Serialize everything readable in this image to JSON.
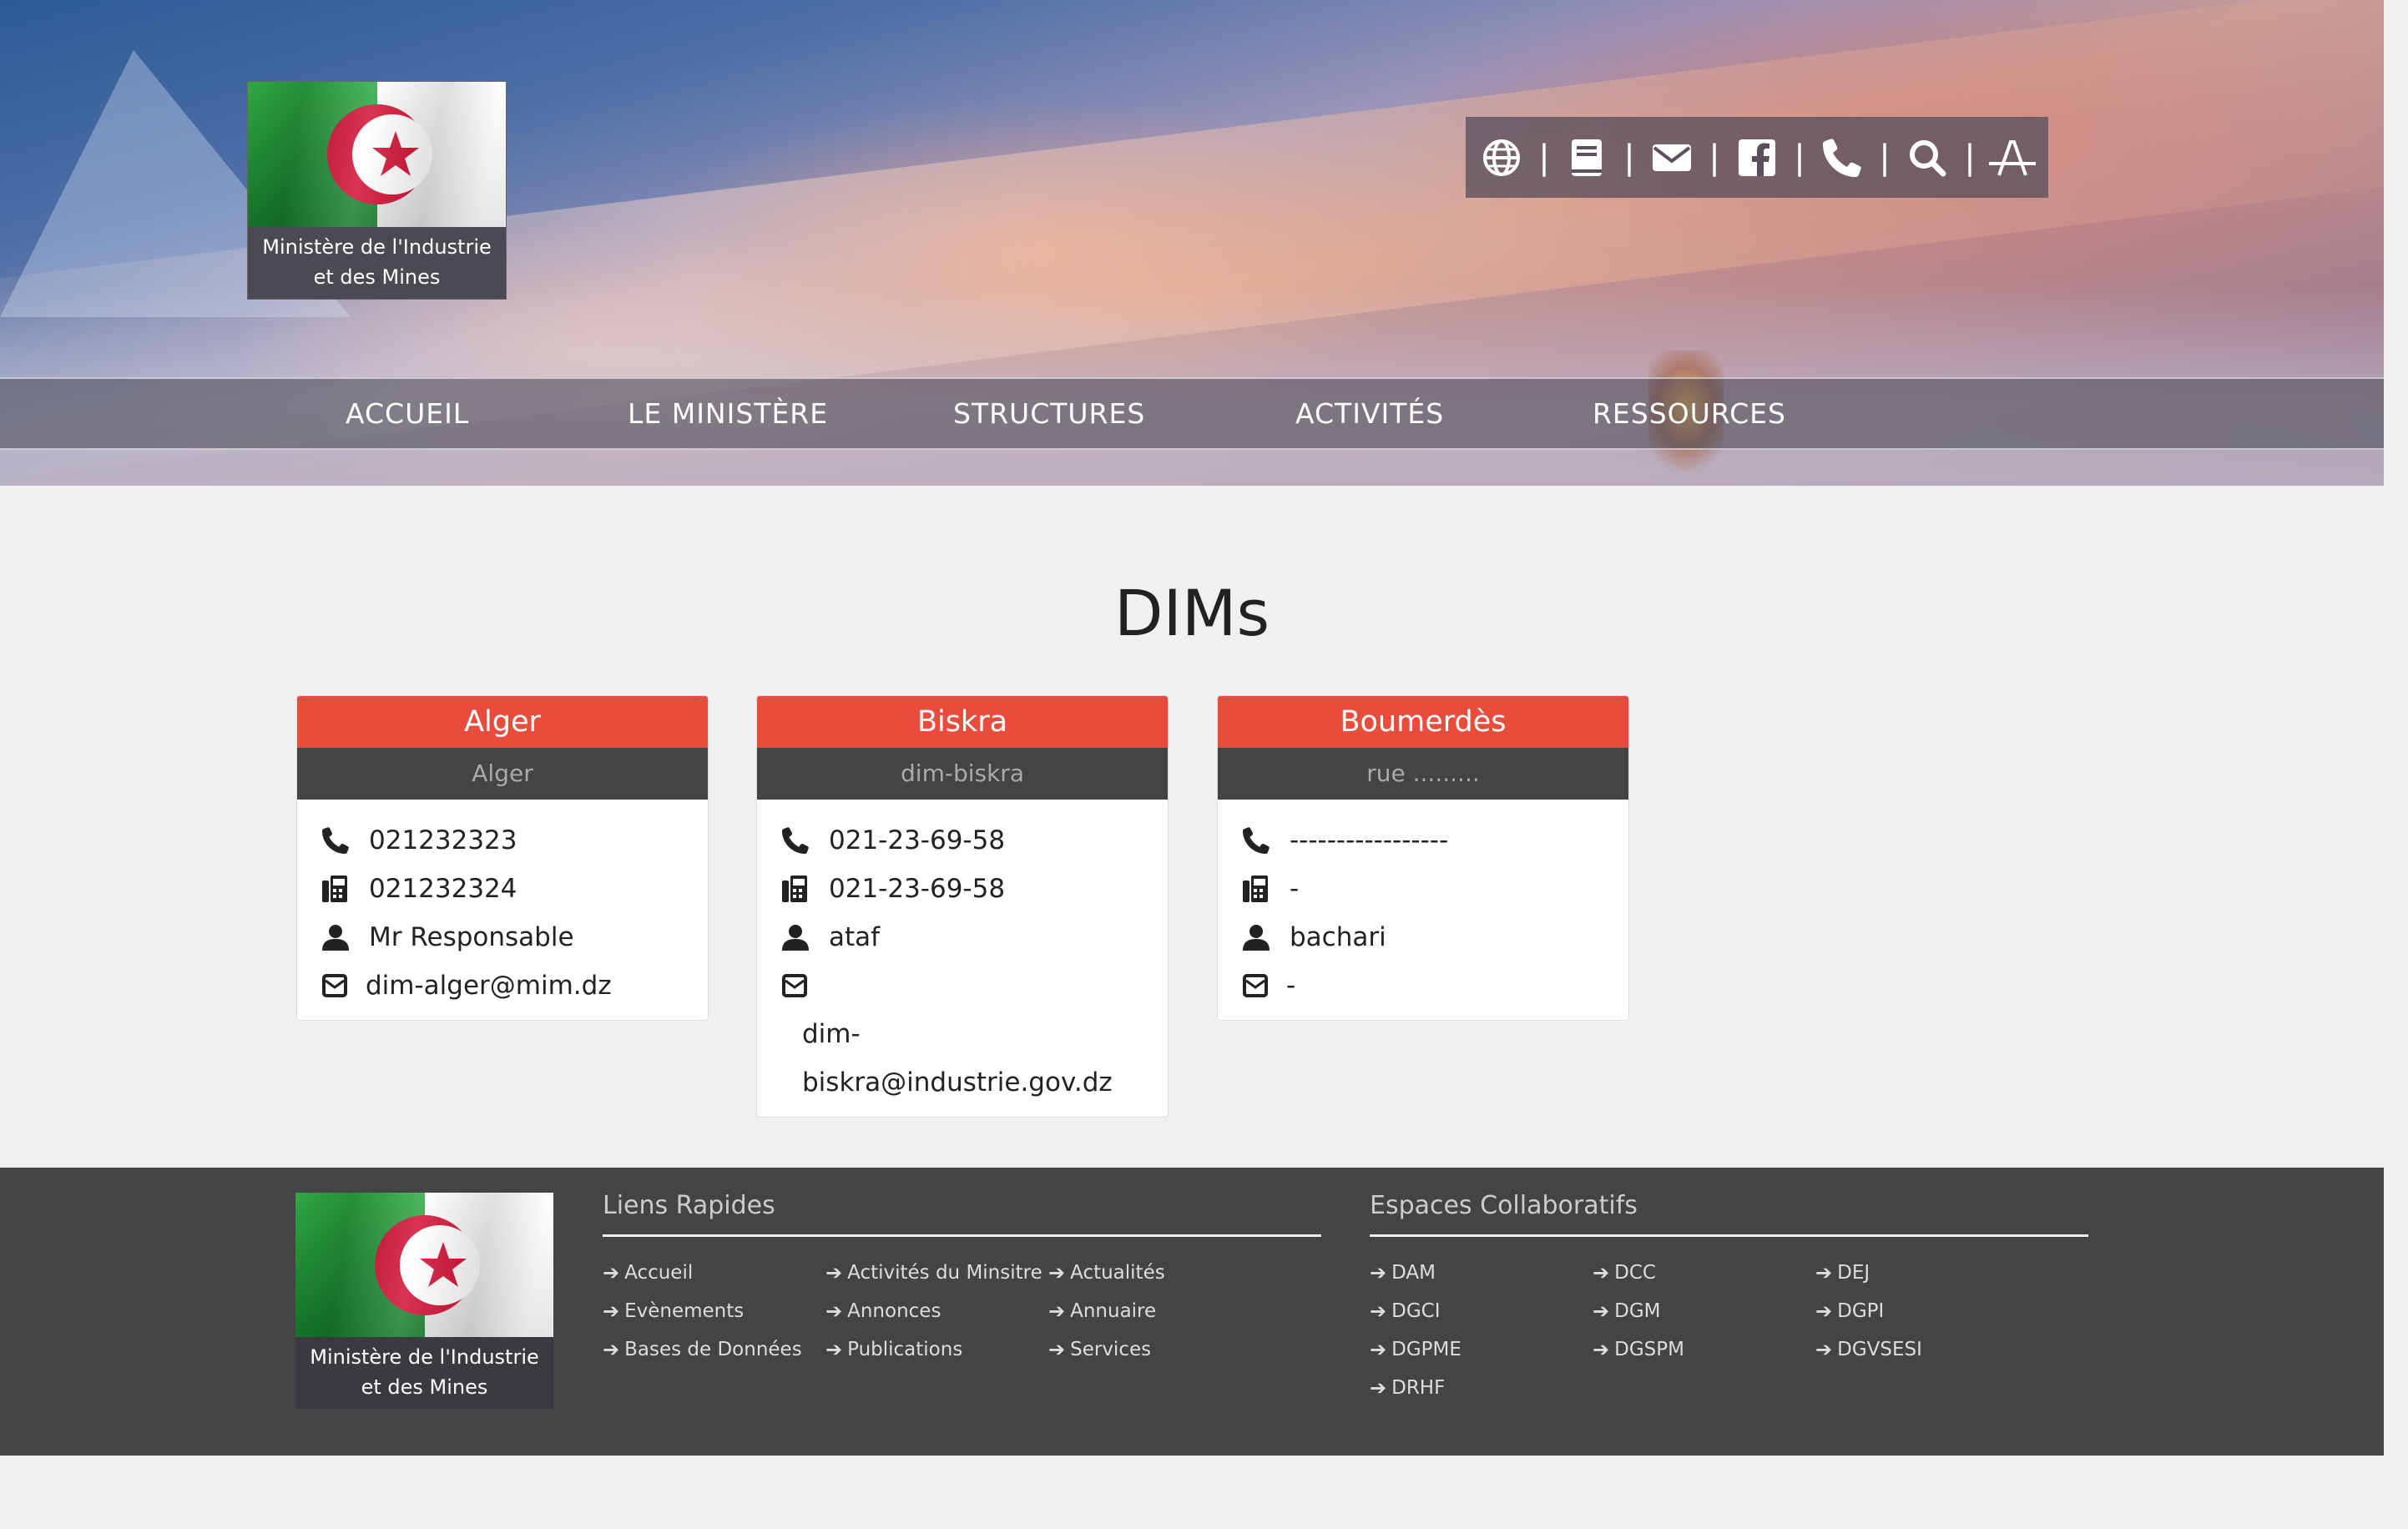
{
  "logo": {
    "caption_line1": "Ministère de l'Industrie",
    "caption_line2": "et des Mines"
  },
  "toolbar": {
    "icons": [
      "globe-icon",
      "book-icon",
      "envelope-icon",
      "facebook-icon",
      "phone-icon",
      "search-icon",
      "text-size-icon"
    ],
    "separator": "|"
  },
  "nav": {
    "items": [
      "ACCUEIL",
      "LE MINISTÈRE",
      "STRUCTURES",
      "ACTIVITÉS",
      "RESSOURCES"
    ]
  },
  "main": {
    "title": "DIMs",
    "colors": {
      "accent": "#e74c3c",
      "subheader": "#444444"
    },
    "cards": [
      {
        "city": "Alger",
        "address": "Alger",
        "phone": "021232323",
        "fax": "021232324",
        "contact": "Mr Responsable",
        "email": "dim-alger@mim.dz"
      },
      {
        "city": "Biskra",
        "address": "dim-biskra",
        "phone": "021-23-69-58",
        "fax": "021-23-69-58",
        "contact": "ataf",
        "email_line1": "dim-",
        "email_line2": "biskra@industrie.gov.dz"
      },
      {
        "city": "Boumerdès",
        "address": "rue .........",
        "phone": "-----------------",
        "fax": "-",
        "contact": "bachari",
        "email": "-"
      }
    ]
  },
  "footer": {
    "logo_caption_line1": "Ministère de l'Industrie",
    "logo_caption_line2": "et des Mines",
    "quick_links": {
      "title": "Liens Rapides",
      "col1": [
        "Accueil",
        "Evènements",
        "Bases de Données"
      ],
      "col2": [
        "Activités du Minsitre",
        "Annonces",
        "Publications"
      ],
      "col3": [
        "Actualités",
        "Annuaire",
        "Services"
      ]
    },
    "collab": {
      "title": "Espaces Collaboratifs",
      "col1": [
        "DAM",
        "DGCI",
        "DGPME",
        "DRHF"
      ],
      "col2": [
        "DCC",
        "DGM",
        "DGSPM"
      ],
      "col3": [
        "DEJ",
        "DGPI",
        "DGVSESI"
      ]
    }
  }
}
